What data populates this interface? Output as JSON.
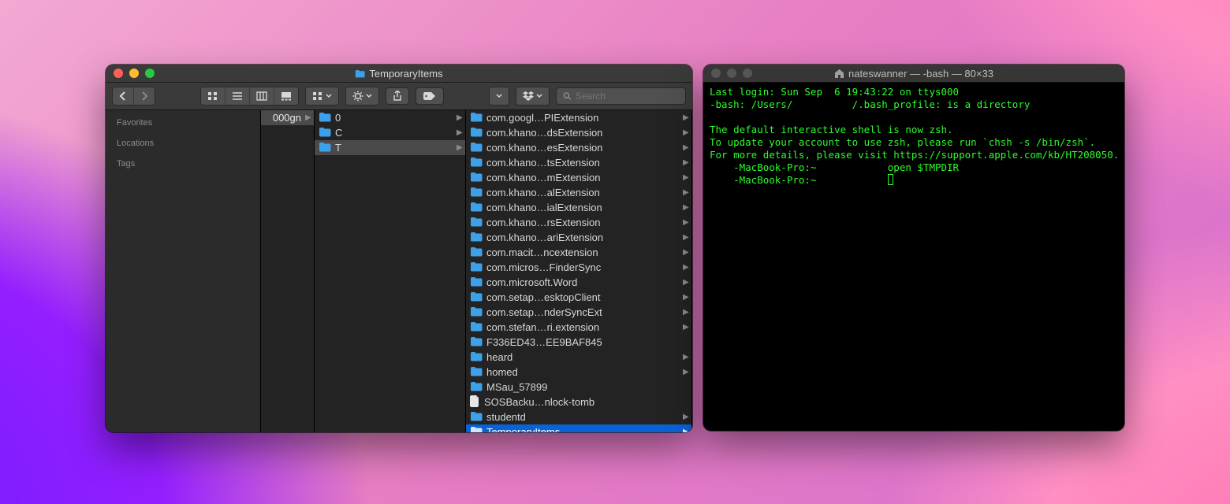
{
  "finder": {
    "title": "TemporaryItems",
    "search_placeholder": "Search",
    "sidebar": {
      "headers": [
        "Favorites",
        "Locations",
        "Tags"
      ]
    },
    "col0_partial": "000gn",
    "col1": [
      {
        "label": "0",
        "folder": true,
        "arrow": true,
        "sel": false
      },
      {
        "label": "C",
        "folder": true,
        "arrow": true,
        "sel": false
      },
      {
        "label": "T",
        "folder": true,
        "arrow": true,
        "sel": true
      }
    ],
    "col2": [
      {
        "label": "com.googl…PIExtension",
        "folder": true,
        "arrow": true
      },
      {
        "label": "com.khano…dsExtension",
        "folder": true,
        "arrow": true
      },
      {
        "label": "com.khano…esExtension",
        "folder": true,
        "arrow": true
      },
      {
        "label": "com.khano…tsExtension",
        "folder": true,
        "arrow": true
      },
      {
        "label": "com.khano…mExtension",
        "folder": true,
        "arrow": true
      },
      {
        "label": "com.khano…alExtension",
        "folder": true,
        "arrow": true
      },
      {
        "label": "com.khano…ialExtension",
        "folder": true,
        "arrow": true
      },
      {
        "label": "com.khano…rsExtension",
        "folder": true,
        "arrow": true
      },
      {
        "label": "com.khano…ariExtension",
        "folder": true,
        "arrow": true
      },
      {
        "label": "com.macit…ncextension",
        "folder": true,
        "arrow": true
      },
      {
        "label": "com.micros…FinderSync",
        "folder": true,
        "arrow": true
      },
      {
        "label": "com.microsoft.Word",
        "folder": true,
        "arrow": true
      },
      {
        "label": "com.setap…esktopClient",
        "folder": true,
        "arrow": true
      },
      {
        "label": "com.setap…nderSyncExt",
        "folder": true,
        "arrow": true
      },
      {
        "label": "com.stefan…ri.extension",
        "folder": true,
        "arrow": true
      },
      {
        "label": "F336ED43…EE9BAF845",
        "folder": true,
        "arrow": false
      },
      {
        "label": "heard",
        "folder": true,
        "arrow": true
      },
      {
        "label": "homed",
        "folder": true,
        "arrow": true
      },
      {
        "label": "MSau_57899",
        "folder": true,
        "arrow": false
      },
      {
        "label": "SOSBacku…nlock-tomb",
        "folder": false,
        "arrow": false
      },
      {
        "label": "studentd",
        "folder": true,
        "arrow": true
      },
      {
        "label": "TemporaryItems",
        "folder": true,
        "arrow": true,
        "selected": true
      }
    ]
  },
  "terminal": {
    "title": "nateswanner — -bash — 80×33",
    "lines": [
      "Last login: Sun Sep  6 19:43:22 on ttys000",
      "-bash: /Users/          /.bash_profile: is a directory",
      "",
      "The default interactive shell is now zsh.",
      "To update your account to use zsh, please run `chsh -s /bin/zsh`.",
      "For more details, please visit https://support.apple.com/kb/HT208050.",
      "    -MacBook-Pro:~            open $TMPDIR",
      "    -MacBook-Pro:~            "
    ]
  }
}
